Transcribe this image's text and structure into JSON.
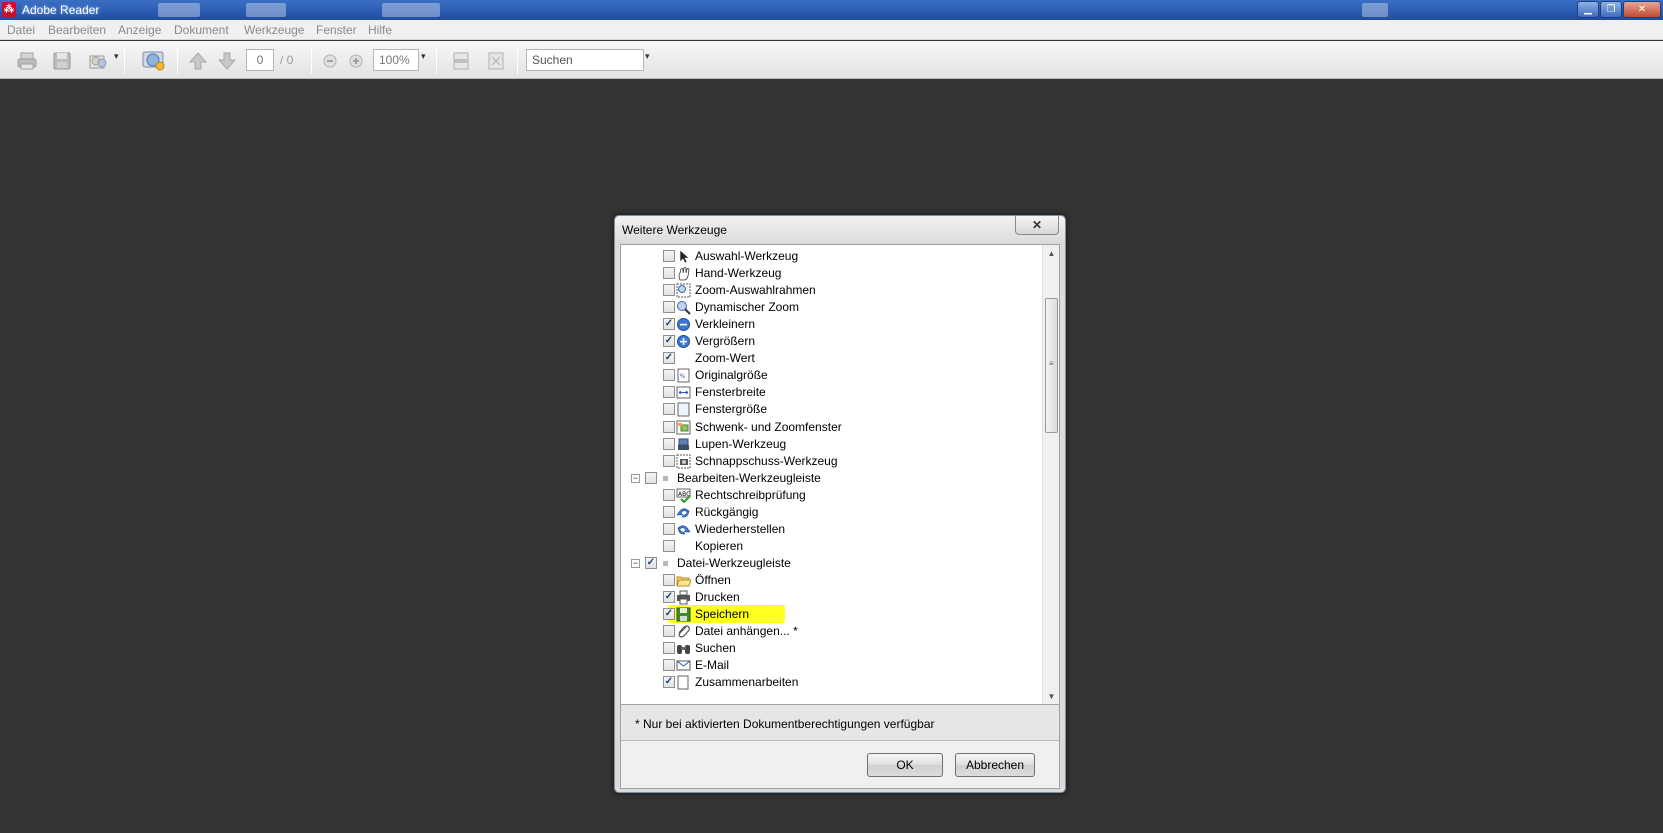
{
  "window": {
    "title": "Adobe Reader",
    "icon": "adobe-pdf-icon"
  },
  "menu": [
    "Datei",
    "Bearbeiten",
    "Anzeige",
    "Dokument",
    "Werkzeuge",
    "Fenster",
    "Hilfe"
  ],
  "toolbar": {
    "page_current": "0",
    "page_total": "/ 0",
    "zoom": "100%",
    "search_placeholder": "Suchen"
  },
  "dialog": {
    "title": "Weitere Werkzeuge",
    "close": "✕",
    "items": [
      {
        "level": 2,
        "label": "Auswahl-Werkzeug",
        "checked": false,
        "icon": "cursor-arrow-icon"
      },
      {
        "level": 2,
        "label": "Hand-Werkzeug",
        "checked": false,
        "icon": "hand-icon"
      },
      {
        "level": 2,
        "label": "Zoom-Auswahlrahmen",
        "checked": false,
        "icon": "zoom-marquee-icon"
      },
      {
        "level": 2,
        "label": "Dynamischer Zoom",
        "checked": false,
        "icon": "dynamic-zoom-icon"
      },
      {
        "level": 2,
        "label": "Verkleinern",
        "checked": true,
        "icon": "zoom-out-icon"
      },
      {
        "level": 2,
        "label": "Vergrößern",
        "checked": true,
        "icon": "zoom-in-icon"
      },
      {
        "level": 2,
        "label": "Zoom-Wert",
        "checked": true,
        "icon": ""
      },
      {
        "level": 2,
        "label": "Originalgröße",
        "checked": false,
        "icon": "actual-size-icon"
      },
      {
        "level": 2,
        "label": "Fensterbreite",
        "checked": false,
        "icon": "fit-width-icon"
      },
      {
        "level": 2,
        "label": "Fenstergröße",
        "checked": false,
        "icon": "fit-page-icon"
      },
      {
        "level": 2,
        "label": "Schwenk- und Zoomfenster",
        "checked": false,
        "icon": "pan-zoom-icon"
      },
      {
        "level": 2,
        "label": "Lupen-Werkzeug",
        "checked": false,
        "icon": "loupe-icon"
      },
      {
        "level": 2,
        "label": "Schnappschuss-Werkzeug",
        "checked": false,
        "icon": "snapshot-icon"
      },
      {
        "level": 1,
        "label": "Bearbeiten-Werkzeugleiste",
        "checked": false,
        "icon": ""
      },
      {
        "level": 2,
        "label": "Rechtschreibprüfung",
        "checked": false,
        "icon": "spellcheck-icon"
      },
      {
        "level": 2,
        "label": "Rückgängig",
        "checked": false,
        "icon": "undo-icon"
      },
      {
        "level": 2,
        "label": "Wiederherstellen",
        "checked": false,
        "icon": "redo-icon"
      },
      {
        "level": 2,
        "label": "Kopieren",
        "checked": false,
        "icon": ""
      },
      {
        "level": 1,
        "label": "Datei-Werkzeugleiste",
        "checked": true,
        "icon": ""
      },
      {
        "level": 2,
        "label": "Öffnen",
        "checked": false,
        "icon": "folder-open-icon"
      },
      {
        "level": 2,
        "label": "Drucken",
        "checked": true,
        "icon": "printer-icon"
      },
      {
        "level": 2,
        "label": "Speichern",
        "checked": true,
        "icon": "save-disk-icon",
        "highlight": true
      },
      {
        "level": 2,
        "label": "Datei anhängen... *",
        "checked": false,
        "icon": "paperclip-icon"
      },
      {
        "level": 2,
        "label": "Suchen",
        "checked": false,
        "icon": "binoculars-icon"
      },
      {
        "level": 2,
        "label": "E-Mail",
        "checked": false,
        "icon": "email-icon"
      },
      {
        "level": 2,
        "label": "Zusammenarbeiten",
        "checked": true,
        "icon": "collaborate-icon"
      }
    ],
    "footnote": "* Nur bei aktivierten Dokumentberechtigungen verfügbar",
    "ok_label": "OK",
    "cancel_label": "Abbrechen"
  },
  "colors": {
    "highlight": "#ffff20",
    "workspace": "#333333",
    "titlebar": "#2a5bb0"
  }
}
